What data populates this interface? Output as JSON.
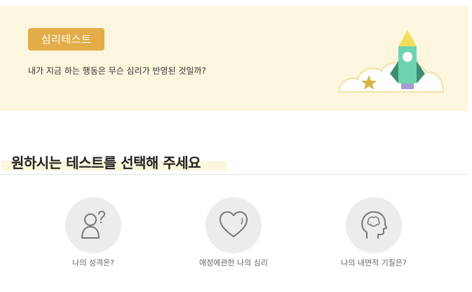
{
  "banner": {
    "badge_label": "심리테스트",
    "description": "내가 지금 하는 행동은 무슨 심리가 반영된 것일까?",
    "illustration": "rocket-cloud-star",
    "colors": {
      "background": "#fbf6dd",
      "badge": "#e2ad49"
    }
  },
  "section": {
    "title": "원하시는 테스트를 선택해 주세요"
  },
  "tests": [
    {
      "label": "나의 성격은?",
      "icon": "person-question-icon"
    },
    {
      "label": "애정에관한 나의 심리",
      "icon": "heart-icon"
    },
    {
      "label": "나의 내면적 기질은?",
      "icon": "head-brain-icon"
    }
  ]
}
